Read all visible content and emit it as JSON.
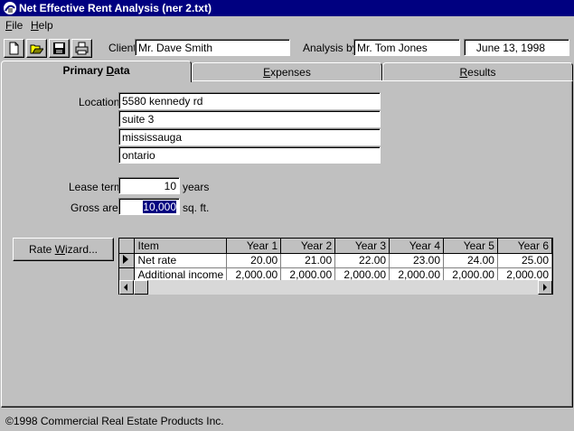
{
  "window": {
    "title": "Net Effective Rent Analysis  (ner 2.txt)"
  },
  "menu": [
    {
      "label": "File",
      "key": "F",
      "rest": "ile"
    },
    {
      "label": "Help",
      "key": "H",
      "rest": "elp"
    }
  ],
  "toolbar": {
    "buttons": [
      "new-icon",
      "open-icon",
      "save-icon",
      "print-icon"
    ],
    "client_label": "Client",
    "client_value": "Mr. Dave Smith",
    "analysis_label": "Analysis by",
    "analysis_value": "Mr. Tom Jones",
    "date_value": "June 13, 1998"
  },
  "tabs": [
    {
      "label": "Primary Data",
      "pre": "Primary ",
      "key": "D",
      "post": "ata",
      "active": true
    },
    {
      "label": "Expenses",
      "pre": "",
      "key": "E",
      "post": "xpenses",
      "active": false
    },
    {
      "label": "Results",
      "pre": "",
      "key": "R",
      "post": "esults",
      "active": false
    }
  ],
  "primary": {
    "location_label": "Location",
    "location_lines": [
      "5580 kennedy rd",
      "suite 3",
      "mississauga",
      "ontario"
    ],
    "lease_term_label": "Lease term",
    "lease_term_value": "10",
    "lease_term_unit": "years",
    "gross_area_label": "Gross area",
    "gross_area_value": "10,000",
    "gross_area_unit": "sq. ft.",
    "rate_wizard_label": "Rate Wizard...",
    "rate_wizard_pre": "Rate ",
    "rate_wizard_key": "W",
    "rate_wizard_post": "izard..."
  },
  "grid": {
    "columns": [
      "Item",
      "Year 1",
      "Year 2",
      "Year 3",
      "Year 4",
      "Year 5",
      "Year 6"
    ],
    "rows": [
      {
        "item": "Net rate",
        "values": [
          "20.00",
          "21.00",
          "22.00",
          "23.00",
          "24.00",
          "25.00"
        ],
        "current": true
      },
      {
        "item": "Additional income",
        "values": [
          "2,000.00",
          "2,000.00",
          "2,000.00",
          "2,000.00",
          "2,000.00",
          "2,000.00"
        ],
        "current": false
      }
    ]
  },
  "status": {
    "text": "©1998 Commercial Real Estate Products Inc."
  }
}
